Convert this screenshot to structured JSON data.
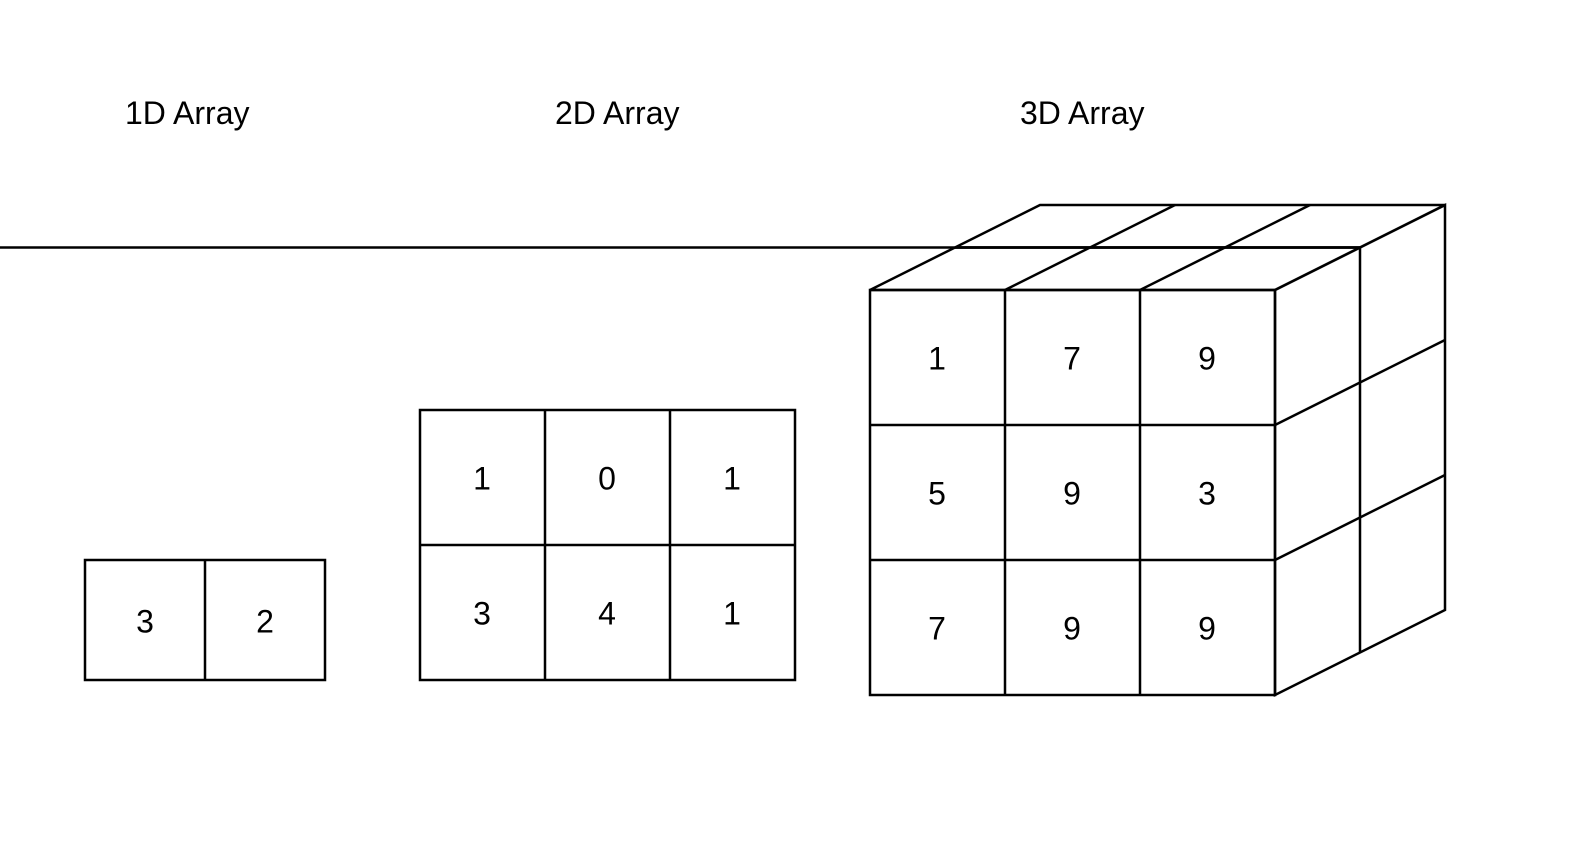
{
  "titles": {
    "one_d": "1D Array",
    "two_d": "2D Array",
    "three_d": "3D Array"
  },
  "one_d": {
    "values": [
      "3",
      "2"
    ]
  },
  "two_d": {
    "rows": [
      [
        "1",
        "0",
        "1"
      ],
      [
        "3",
        "4",
        "1"
      ]
    ]
  },
  "three_d": {
    "front_rows": [
      [
        "1",
        "7",
        "9"
      ],
      [
        "5",
        "9",
        "3"
      ],
      [
        "7",
        "9",
        "9"
      ]
    ]
  }
}
